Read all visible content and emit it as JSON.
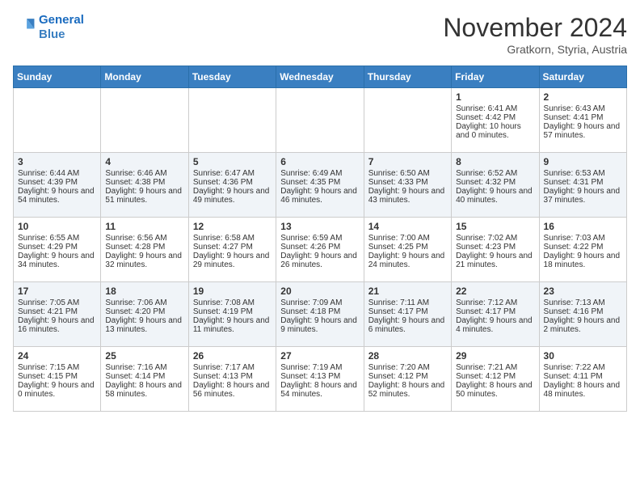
{
  "header": {
    "logo_line1": "General",
    "logo_line2": "Blue",
    "month": "November 2024",
    "location": "Gratkorn, Styria, Austria"
  },
  "weekdays": [
    "Sunday",
    "Monday",
    "Tuesday",
    "Wednesday",
    "Thursday",
    "Friday",
    "Saturday"
  ],
  "weeks": [
    [
      {
        "day": "",
        "sunrise": "",
        "sunset": "",
        "daylight": ""
      },
      {
        "day": "",
        "sunrise": "",
        "sunset": "",
        "daylight": ""
      },
      {
        "day": "",
        "sunrise": "",
        "sunset": "",
        "daylight": ""
      },
      {
        "day": "",
        "sunrise": "",
        "sunset": "",
        "daylight": ""
      },
      {
        "day": "",
        "sunrise": "",
        "sunset": "",
        "daylight": ""
      },
      {
        "day": "1",
        "sunrise": "Sunrise: 6:41 AM",
        "sunset": "Sunset: 4:42 PM",
        "daylight": "Daylight: 10 hours and 0 minutes."
      },
      {
        "day": "2",
        "sunrise": "Sunrise: 6:43 AM",
        "sunset": "Sunset: 4:41 PM",
        "daylight": "Daylight: 9 hours and 57 minutes."
      }
    ],
    [
      {
        "day": "3",
        "sunrise": "Sunrise: 6:44 AM",
        "sunset": "Sunset: 4:39 PM",
        "daylight": "Daylight: 9 hours and 54 minutes."
      },
      {
        "day": "4",
        "sunrise": "Sunrise: 6:46 AM",
        "sunset": "Sunset: 4:38 PM",
        "daylight": "Daylight: 9 hours and 51 minutes."
      },
      {
        "day": "5",
        "sunrise": "Sunrise: 6:47 AM",
        "sunset": "Sunset: 4:36 PM",
        "daylight": "Daylight: 9 hours and 49 minutes."
      },
      {
        "day": "6",
        "sunrise": "Sunrise: 6:49 AM",
        "sunset": "Sunset: 4:35 PM",
        "daylight": "Daylight: 9 hours and 46 minutes."
      },
      {
        "day": "7",
        "sunrise": "Sunrise: 6:50 AM",
        "sunset": "Sunset: 4:33 PM",
        "daylight": "Daylight: 9 hours and 43 minutes."
      },
      {
        "day": "8",
        "sunrise": "Sunrise: 6:52 AM",
        "sunset": "Sunset: 4:32 PM",
        "daylight": "Daylight: 9 hours and 40 minutes."
      },
      {
        "day": "9",
        "sunrise": "Sunrise: 6:53 AM",
        "sunset": "Sunset: 4:31 PM",
        "daylight": "Daylight: 9 hours and 37 minutes."
      }
    ],
    [
      {
        "day": "10",
        "sunrise": "Sunrise: 6:55 AM",
        "sunset": "Sunset: 4:29 PM",
        "daylight": "Daylight: 9 hours and 34 minutes."
      },
      {
        "day": "11",
        "sunrise": "Sunrise: 6:56 AM",
        "sunset": "Sunset: 4:28 PM",
        "daylight": "Daylight: 9 hours and 32 minutes."
      },
      {
        "day": "12",
        "sunrise": "Sunrise: 6:58 AM",
        "sunset": "Sunset: 4:27 PM",
        "daylight": "Daylight: 9 hours and 29 minutes."
      },
      {
        "day": "13",
        "sunrise": "Sunrise: 6:59 AM",
        "sunset": "Sunset: 4:26 PM",
        "daylight": "Daylight: 9 hours and 26 minutes."
      },
      {
        "day": "14",
        "sunrise": "Sunrise: 7:00 AM",
        "sunset": "Sunset: 4:25 PM",
        "daylight": "Daylight: 9 hours and 24 minutes."
      },
      {
        "day": "15",
        "sunrise": "Sunrise: 7:02 AM",
        "sunset": "Sunset: 4:23 PM",
        "daylight": "Daylight: 9 hours and 21 minutes."
      },
      {
        "day": "16",
        "sunrise": "Sunrise: 7:03 AM",
        "sunset": "Sunset: 4:22 PM",
        "daylight": "Daylight: 9 hours and 18 minutes."
      }
    ],
    [
      {
        "day": "17",
        "sunrise": "Sunrise: 7:05 AM",
        "sunset": "Sunset: 4:21 PM",
        "daylight": "Daylight: 9 hours and 16 minutes."
      },
      {
        "day": "18",
        "sunrise": "Sunrise: 7:06 AM",
        "sunset": "Sunset: 4:20 PM",
        "daylight": "Daylight: 9 hours and 13 minutes."
      },
      {
        "day": "19",
        "sunrise": "Sunrise: 7:08 AM",
        "sunset": "Sunset: 4:19 PM",
        "daylight": "Daylight: 9 hours and 11 minutes."
      },
      {
        "day": "20",
        "sunrise": "Sunrise: 7:09 AM",
        "sunset": "Sunset: 4:18 PM",
        "daylight": "Daylight: 9 hours and 9 minutes."
      },
      {
        "day": "21",
        "sunrise": "Sunrise: 7:11 AM",
        "sunset": "Sunset: 4:17 PM",
        "daylight": "Daylight: 9 hours and 6 minutes."
      },
      {
        "day": "22",
        "sunrise": "Sunrise: 7:12 AM",
        "sunset": "Sunset: 4:17 PM",
        "daylight": "Daylight: 9 hours and 4 minutes."
      },
      {
        "day": "23",
        "sunrise": "Sunrise: 7:13 AM",
        "sunset": "Sunset: 4:16 PM",
        "daylight": "Daylight: 9 hours and 2 minutes."
      }
    ],
    [
      {
        "day": "24",
        "sunrise": "Sunrise: 7:15 AM",
        "sunset": "Sunset: 4:15 PM",
        "daylight": "Daylight: 9 hours and 0 minutes."
      },
      {
        "day": "25",
        "sunrise": "Sunrise: 7:16 AM",
        "sunset": "Sunset: 4:14 PM",
        "daylight": "Daylight: 8 hours and 58 minutes."
      },
      {
        "day": "26",
        "sunrise": "Sunrise: 7:17 AM",
        "sunset": "Sunset: 4:13 PM",
        "daylight": "Daylight: 8 hours and 56 minutes."
      },
      {
        "day": "27",
        "sunrise": "Sunrise: 7:19 AM",
        "sunset": "Sunset: 4:13 PM",
        "daylight": "Daylight: 8 hours and 54 minutes."
      },
      {
        "day": "28",
        "sunrise": "Sunrise: 7:20 AM",
        "sunset": "Sunset: 4:12 PM",
        "daylight": "Daylight: 8 hours and 52 minutes."
      },
      {
        "day": "29",
        "sunrise": "Sunrise: 7:21 AM",
        "sunset": "Sunset: 4:12 PM",
        "daylight": "Daylight: 8 hours and 50 minutes."
      },
      {
        "day": "30",
        "sunrise": "Sunrise: 7:22 AM",
        "sunset": "Sunset: 4:11 PM",
        "daylight": "Daylight: 8 hours and 48 minutes."
      }
    ]
  ]
}
